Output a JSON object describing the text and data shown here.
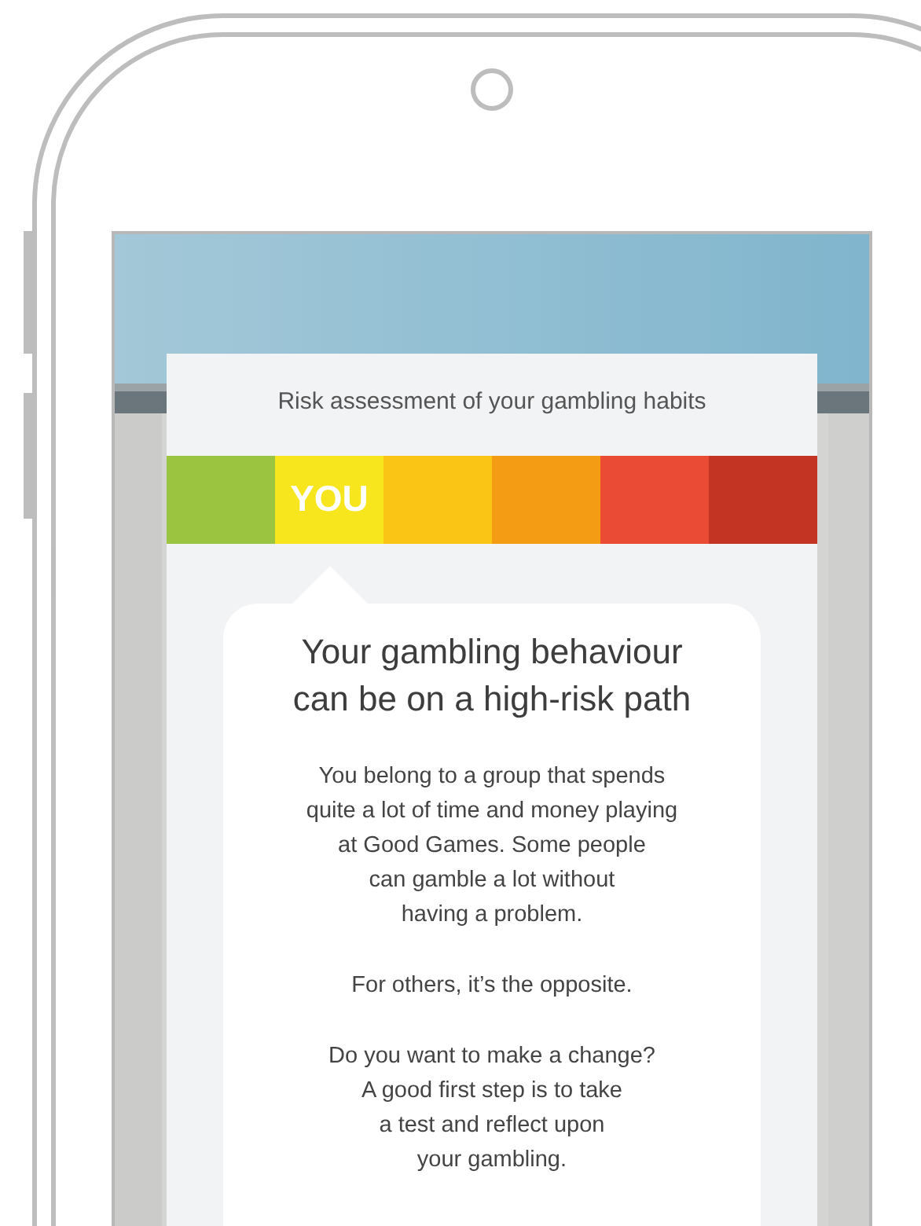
{
  "card": {
    "title": "Risk assessment of your gambling habits",
    "marker_label": "YOU",
    "risk_scale": [
      {
        "color": "#9bc440",
        "selected": false
      },
      {
        "color": "#f7e51d",
        "selected": true
      },
      {
        "color": "#fbc515",
        "selected": false
      },
      {
        "color": "#f49c13",
        "selected": false
      },
      {
        "color": "#e94b35",
        "selected": false
      },
      {
        "color": "#c33522",
        "selected": false
      }
    ],
    "result": {
      "heading": "Your gambling behaviour\ncan be on a high-risk path",
      "paragraphs": [
        "You belong to a group that spends\nquite a lot of time and money playing\nat Good Games. Some people\ncan gamble a lot without\nhaving a problem.",
        "For others, it’s the opposite.",
        "Do you want to make a change?\nA good first step is to take\na test and reflect upon\nyour gambling."
      ]
    }
  }
}
